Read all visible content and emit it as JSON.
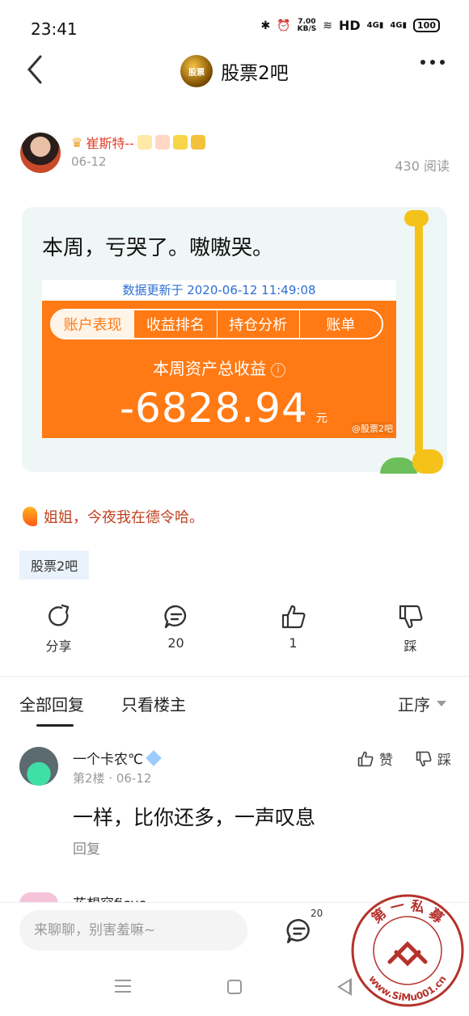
{
  "status_bar": {
    "time": "23:41",
    "speed_value": "7.00",
    "speed_unit": "KB/S",
    "hd": "HD",
    "network_1": "4G",
    "network_2": "4G",
    "battery": "100"
  },
  "header": {
    "forum_name": "股票2吧",
    "forum_logo_text": "股票"
  },
  "post": {
    "author_name": "崔斯特--",
    "date": "06-12",
    "read_count": "430 阅读",
    "text": "本周，亏哭了。嗷嗷哭。",
    "signature": "姐姐，今夜我在德令哈。",
    "forum_tag": "股票2吧"
  },
  "screenshot": {
    "updated": "数据更新于 2020-06-12 11:49:08",
    "tabs": [
      "账户表现",
      "收益排名",
      "持仓分析",
      "账单"
    ],
    "weekly_label": "本周资产总收益",
    "info_glyph": "i",
    "amount": "-6828.94",
    "unit": "元",
    "watermark": "@股票2吧"
  },
  "actions": {
    "share": "分享",
    "comments": "20",
    "likes": "1",
    "dislike": "踩"
  },
  "replies_header": {
    "all": "全部回复",
    "owner_only": "只看楼主",
    "sort": "正序"
  },
  "reply": {
    "name": "一个卡农℃",
    "meta": "第2楼 · 06-12",
    "like_label": "赞",
    "dislike_label": "踩",
    "content": "一样，比你还多，一声叹息",
    "reply_label": "回复"
  },
  "next_reply": {
    "name_partial": "花想容ficus"
  },
  "bottom_bar": {
    "placeholder": "来聊聊，别害羞嘛~",
    "comment_count": "20"
  },
  "seal": {
    "top_text": "第 一 私 募",
    "url": "www.SiMu001.cn"
  },
  "colors": {
    "orange": "#ff7a14",
    "author_red": "#e0412b",
    "link_blue": "#2d6fd6"
  }
}
